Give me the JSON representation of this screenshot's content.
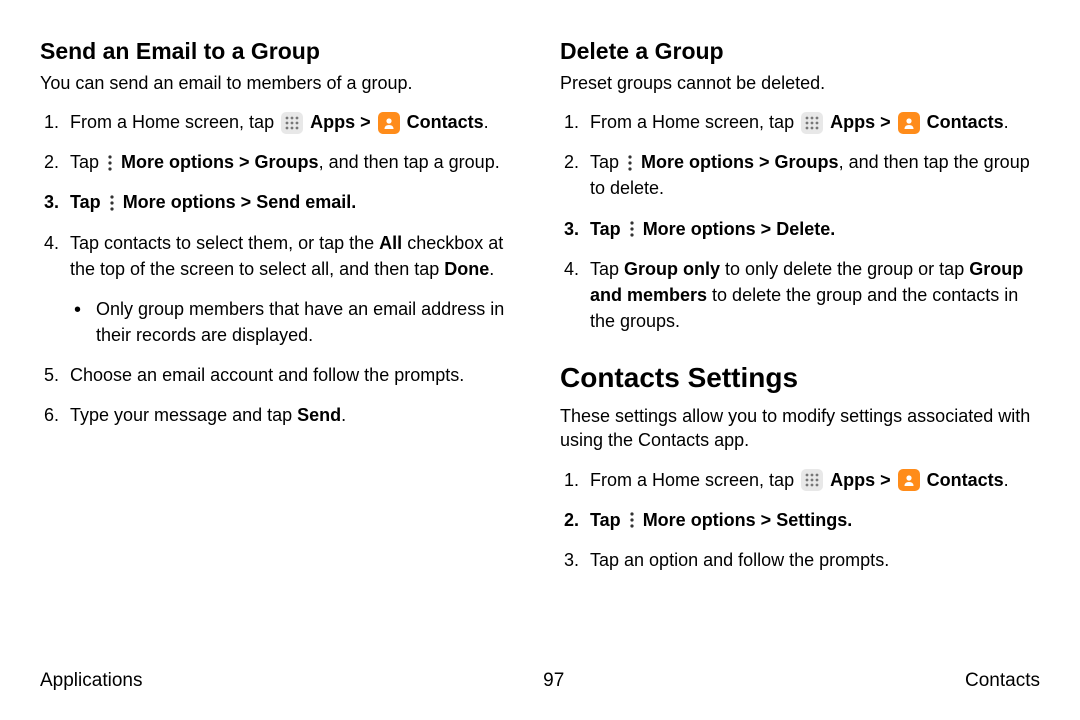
{
  "left": {
    "heading": "Send an Email to a Group",
    "intro": "You can send an email to members of a group.",
    "step1_a": "From a Home screen, tap ",
    "apps_label": "Apps",
    "chevron": " > ",
    "contacts_label": "Contacts",
    "step2_a": "Tap ",
    "step2_b": "More options > Groups",
    "step2_c": ", and then tap a group.",
    "step3_a": "Tap ",
    "step3_b": "More options > Send email",
    "step4_a": "Tap contacts to select them, or tap the ",
    "step4_b": "All",
    "step4_c": " checkbox at the top of the screen to select all, and then tap ",
    "step4_d": "Done",
    "step4_sub": "Only group members that have an email address in their records are displayed.",
    "step5": "Choose an email account and follow the prompts.",
    "step6_a": "Type your message and tap ",
    "step6_b": "Send"
  },
  "right_delete": {
    "heading": "Delete a Group",
    "intro": "Preset groups cannot be deleted.",
    "step1_a": "From a Home screen, tap ",
    "step2_a": "Tap ",
    "step2_b": "More options > Groups",
    "step2_c": ", and then tap the group to delete.",
    "step3_a": "Tap ",
    "step3_b": "More options > Delete",
    "step4_a": "Tap ",
    "step4_b": "Group only",
    "step4_c": " to only delete the group or tap ",
    "step4_d": "Group and members",
    "step4_e": " to delete the group and the contacts in the groups."
  },
  "right_settings": {
    "heading": "Contacts Settings",
    "intro": "These settings allow you to modify settings associated with using the Contacts app.",
    "step1_a": "From a Home screen, tap ",
    "step2_a": "Tap ",
    "step2_b": "More options > Settings",
    "step3": "Tap an option and follow the prompts."
  },
  "footer": {
    "left": "Applications",
    "center": "97",
    "right": "Contacts"
  }
}
